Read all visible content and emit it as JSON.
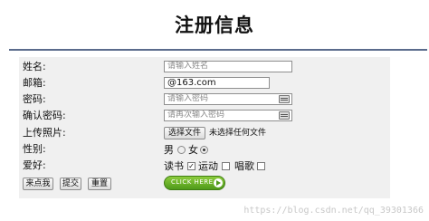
{
  "title": "注册信息",
  "form": {
    "name_label": "姓名:",
    "name_placeholder": "请输入姓名",
    "email_label": "邮箱:",
    "email_value": "@163.com",
    "password_label": "密码:",
    "password_placeholder": "请输入密码",
    "confirm_label": "确认密码:",
    "confirm_placeholder": "请再次输入密码",
    "photo_label": "上传照片:",
    "choose_file_button": "选择文件",
    "no_file_text": "未选择任何文件",
    "gender_label": "性别:",
    "gender_options": [
      "男",
      "女"
    ],
    "gender_selected": "女",
    "hobby_label": "爱好:",
    "hobbies": [
      {
        "label": "读书",
        "checked": true
      },
      {
        "label": "运动",
        "checked": false
      },
      {
        "label": "唱歌",
        "checked": false
      }
    ],
    "buttons": {
      "click_me": "来点我",
      "submit": "提交",
      "reset": "重置"
    },
    "click_here": "CLICK HERE"
  },
  "watermark": "https://blog.csdn.net/qq_39301366"
}
